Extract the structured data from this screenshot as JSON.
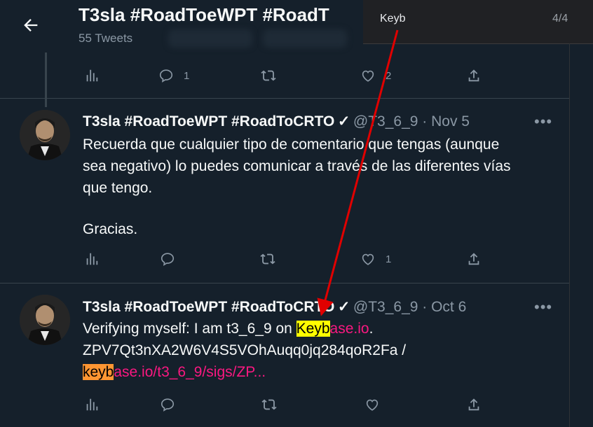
{
  "header": {
    "title": "T3sla #RoadToeWPT #RoadT",
    "subtitle": "55 Tweets"
  },
  "find_bar": {
    "query": "Keyb",
    "count": "4/4"
  },
  "top_actions": {
    "reply_count": "1",
    "like_count": "2"
  },
  "tweets": [
    {
      "name": "T3sla #RoadToeWPT #RoadToCRTO",
      "verified": "✓",
      "handle": "@T3_6_9 · Nov 5",
      "lines": [
        "Recuerda que cualquier tipo de comentario que tengas (aunque",
        "sea negativo) lo puedes comunicar a través de las diferentes vías",
        "que tengo.",
        "Gracias."
      ],
      "reply_count": "",
      "like_count": "1"
    },
    {
      "name": "T3sla #RoadToeWPT #RoadToCRTO",
      "verified": "✓",
      "handle": "@T3_6_9 · Oct 6",
      "line1_prefix": "Verifying myself: I am t3_6_9 on ",
      "line1_hl": "Keyb",
      "line1_link": "ase.io",
      "line1_suffix": ".",
      "line2": "ZPV7Qt3nXA2W6V4S5VOhAuqq0jq284qoR2Fa /",
      "line3_hl": "keyb",
      "line3_link": "ase.io/t3_6_9/sigs/ZP...",
      "reply_count": "",
      "like_count": ""
    }
  ],
  "colors": {
    "background": "#15202b",
    "accent_link": "#f91880",
    "highlight_current": "#ffff00",
    "highlight_match": "#ff9632",
    "annotation_arrow": "#e00000"
  },
  "icons": [
    "back-arrow-icon",
    "analytics-icon",
    "reply-icon",
    "retweet-icon",
    "like-icon",
    "share-icon",
    "more-icon"
  ]
}
